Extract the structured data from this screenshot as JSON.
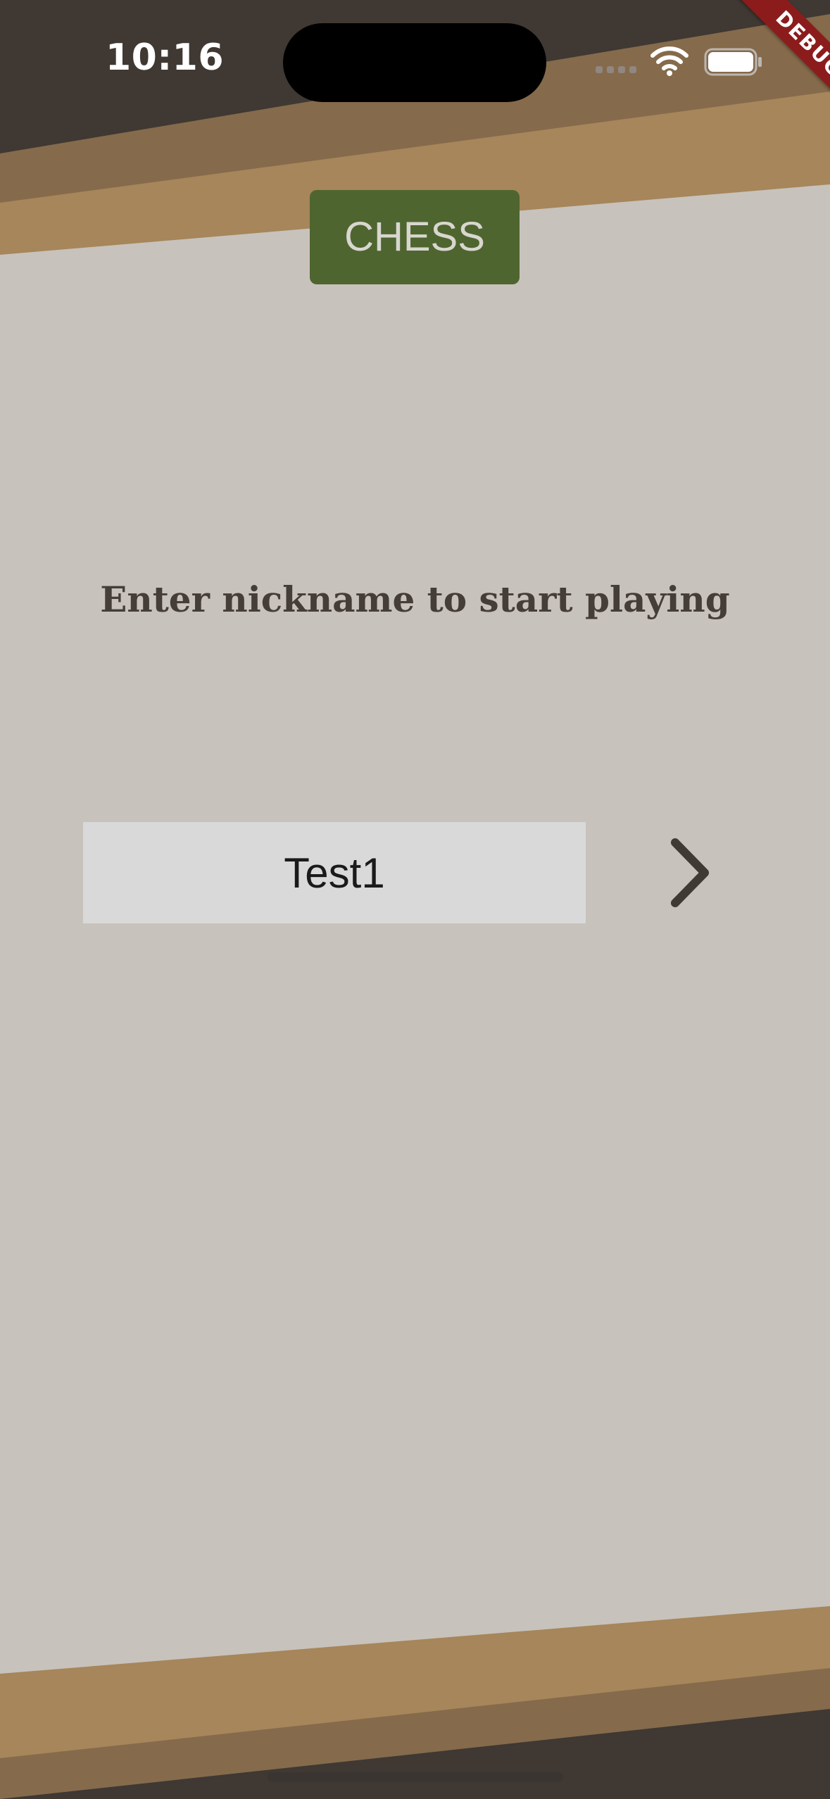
{
  "status_bar": {
    "time": "10:16",
    "signal_icon": "cellular-signal-icon",
    "wifi_icon": "wifi-icon",
    "battery_icon": "battery-icon"
  },
  "debug_banner": {
    "label": "DEBUG",
    "color": "#8c1c1c"
  },
  "header": {
    "title": "CHESS",
    "color": "#4e6530"
  },
  "main": {
    "prompt": "Enter nickname to start playing",
    "nickname_input": {
      "value": "Test1"
    },
    "next_icon": "chevron-right-icon"
  },
  "colors": {
    "background": "#c8c2bc",
    "stripe_light": "#a6865a",
    "stripe_mid": "#856a4c",
    "stripe_dark": "#3f3833",
    "text_dark": "#453d37"
  }
}
